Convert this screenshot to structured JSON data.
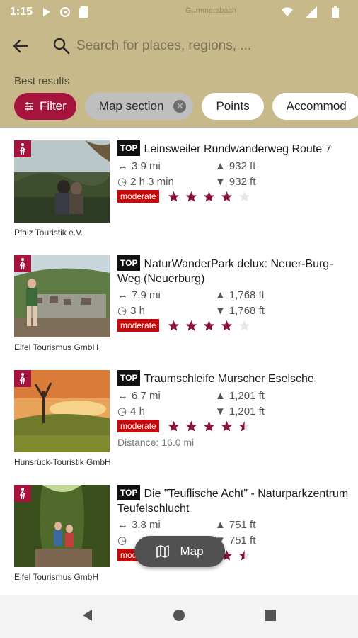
{
  "status_bar": {
    "time": "1:15",
    "map_hint": "Gummersbach"
  },
  "search": {
    "placeholder": "Search for places, regions, ..."
  },
  "filters": {
    "heading": "Best results",
    "filter_label": "Filter",
    "map_section_label": "Map section",
    "points_label": "Points",
    "accommodation_label": "Accommod"
  },
  "results": [
    {
      "badge": "TOP",
      "title": "Leinsweiler Rundwanderweg Route 7",
      "distance": "3.9 mi",
      "ascent": "932 ft",
      "duration": "2 h 3 min",
      "descent": "932 ft",
      "difficulty": "moderate",
      "rating": 4,
      "source": "Pfalz Touristik e.V."
    },
    {
      "badge": "TOP",
      "title": "NaturWanderPark delux: Neuer-Burg-Weg (Neuerburg)",
      "distance": "7.9 mi",
      "ascent": "1,768 ft",
      "duration": "3 h",
      "descent": "1,768 ft",
      "difficulty": "moderate",
      "rating": 4,
      "source": "Eifel Tourismus GmbH"
    },
    {
      "badge": "TOP",
      "title": "Traumschleife Murscher Eselsche",
      "distance": "6.7 mi",
      "ascent": "1,201 ft",
      "duration": "4 h",
      "descent": "1,201 ft",
      "difficulty": "moderate",
      "rating": 4.5,
      "distance_from": "Distance: 16.0 mi",
      "source": "Hunsrück-Touristik GmbH"
    },
    {
      "badge": "TOP",
      "title": "Die \"Teuflische Acht\" - Naturparkzentrum Teufelschlucht",
      "distance": "3.8 mi",
      "ascent": "751 ft",
      "duration": "",
      "descent": "751 ft",
      "difficulty": "moderate",
      "rating": 4.5,
      "source": "Eifel Tourismus GmbH"
    }
  ],
  "map_button": {
    "label": "Map"
  },
  "colors": {
    "header": "#c8b98a",
    "accent": "#a5143c",
    "difficulty": "#c40a0a"
  }
}
